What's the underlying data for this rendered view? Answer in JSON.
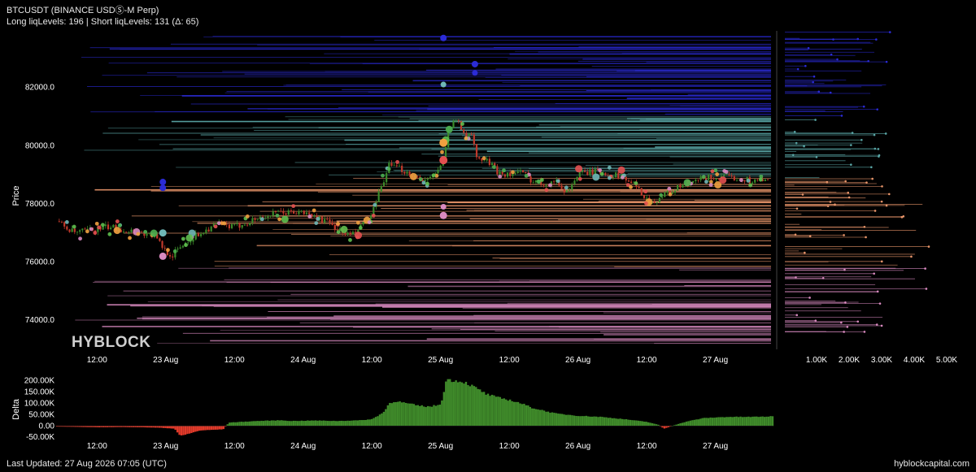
{
  "header": {
    "title": "BTCUSDT (BINANCE USDⓈ-M Perp)",
    "subtitle": "Long liqLevels: 196 | Short liqLevels: 131 (Δ: 65)"
  },
  "watermark": "HYBLOCK",
  "footer": {
    "last_updated": "Last Updated: 27 Aug 2026 07:05 (UTC)",
    "site": "hyblockcapital.com"
  },
  "colors": {
    "background": "#000000",
    "candle_up": "#3a8a2a",
    "candle_down": "#c0392b",
    "delta_positive": "#3f8a2a",
    "delta_negative": "#e03a2a",
    "short_levels": "#2b2bd6",
    "mid_levels": "#5aa7a7",
    "long_levels": "#e8956a",
    "long_levels_far": "#d98ac0"
  },
  "chart_data": [
    {
      "name": "price",
      "type": "line",
      "ylabel": "Price",
      "ylim": [
        73000,
        84000
      ],
      "y_ticks": [
        "82000.0",
        "80000.0",
        "78000.0",
        "76000.0",
        "74000.0"
      ],
      "y_tick_values": [
        82000,
        80000,
        78000,
        76000,
        74000
      ],
      "x_ticks": [
        "12:00",
        "23 Aug",
        "12:00",
        "24 Aug",
        "12:00",
        "25 Aug",
        "12:00",
        "26 Aug",
        "12:00",
        "27 Aug"
      ],
      "x_tick_hours": [
        12,
        24,
        36,
        48,
        60,
        72,
        84,
        96,
        108,
        120
      ],
      "xlim_hours": [
        5,
        130
      ],
      "price_path": {
        "hours": [
          5,
          8,
          11,
          14,
          17,
          20,
          22,
          23.5,
          25,
          27,
          30,
          33,
          36,
          40,
          44,
          48,
          52,
          55,
          56.5,
          58,
          60,
          61,
          62,
          63,
          65,
          68,
          70,
          71.5,
          72.5,
          73.5,
          75,
          76.5,
          77.5,
          78,
          78.5,
          80,
          82,
          84,
          86,
          88,
          90,
          92,
          94,
          96,
          98,
          100,
          102,
          104,
          105.5,
          107,
          108,
          109,
          110,
          112,
          114,
          116,
          118,
          120,
          122,
          124,
          126,
          128,
          130
        ],
        "prices": [
          77400,
          77000,
          77100,
          77200,
          77100,
          77000,
          76900,
          76500,
          76200,
          76600,
          77000,
          77300,
          77200,
          77500,
          77700,
          77700,
          77400,
          77000,
          76900,
          77200,
          77600,
          78200,
          78800,
          79300,
          79200,
          78900,
          78800,
          79100,
          79700,
          80600,
          80900,
          80300,
          80400,
          79800,
          79500,
          79500,
          79100,
          79000,
          79100,
          78800,
          78700,
          78800,
          78400,
          79000,
          79100,
          79100,
          79000,
          78900,
          78700,
          78400,
          78200,
          78000,
          78200,
          78400,
          78600,
          78700,
          78900,
          78900,
          78900,
          78900,
          78800,
          78800,
          78750
        ]
      },
      "liq_cluster": {
        "x_ticks": [
          "1.00K",
          "2.00K",
          "3.00K",
          "4.00K",
          "5.00K"
        ],
        "x_tick_values": [
          1000,
          2000,
          3000,
          4000,
          5000
        ]
      }
    },
    {
      "name": "delta",
      "type": "area",
      "ylabel": "Delta",
      "ylim": [
        -60000,
        220000
      ],
      "y_ticks": [
        "200.00K",
        "150.00K",
        "100.00K",
        "50.00K",
        "0.00",
        "-50.00K"
      ],
      "y_tick_values": [
        200000,
        150000,
        100000,
        50000,
        0,
        -50000
      ],
      "x_ticks": [
        "12:00",
        "23 Aug",
        "12:00",
        "24 Aug",
        "12:00",
        "25 Aug",
        "12:00",
        "26 Aug",
        "12:00",
        "27 Aug"
      ],
      "x_tick_hours": [
        12,
        24,
        36,
        48,
        60,
        72,
        84,
        96,
        108,
        120
      ],
      "xlim_hours": [
        5,
        130
      ],
      "series": {
        "hours": [
          5,
          8,
          12,
          16,
          20,
          23,
          25.5,
          26.5,
          30,
          34,
          35,
          40,
          44,
          46,
          50,
          54,
          58,
          60,
          62,
          63,
          64,
          66,
          68,
          70,
          72,
          73,
          76,
          78,
          80,
          82,
          84,
          86,
          88,
          92,
          96,
          100,
          104,
          108,
          110,
          111,
          113,
          115,
          118,
          122,
          126,
          130
        ],
        "values": [
          -3000,
          -4000,
          -6000,
          -5000,
          -6000,
          -8000,
          -12000,
          -45000,
          -20000,
          -15000,
          15000,
          22000,
          25000,
          22000,
          24000,
          22000,
          25000,
          30000,
          60000,
          100000,
          110000,
          100000,
          90000,
          85000,
          95000,
          205000,
          195000,
          170000,
          140000,
          125000,
          115000,
          100000,
          80000,
          55000,
          45000,
          40000,
          30000,
          18000,
          5000,
          -12000,
          5000,
          20000,
          35000,
          40000,
          40000,
          42000
        ]
      }
    }
  ]
}
